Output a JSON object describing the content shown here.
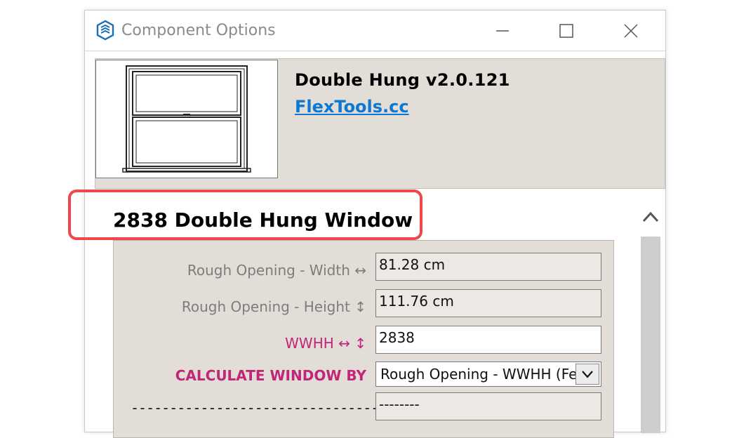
{
  "window": {
    "title": "Component Options",
    "icon": "sketchup-logo-icon",
    "controls": [
      "minimize-icon",
      "maximize-icon",
      "close-icon"
    ]
  },
  "component": {
    "name": "Double Hung v2.0.121",
    "link_text": "FlexTools.cc",
    "thumbnail_icon": "double-hung-window-thumbnail"
  },
  "section": {
    "title": "2838 Double Hung Window"
  },
  "form": {
    "rows": [
      {
        "label": "Rough Opening - Width ↔",
        "value": "81.28 cm"
      },
      {
        "label": "Rough Opening - Height ↕",
        "value": "111.76 cm"
      },
      {
        "label": "WWHH ↔ ↕",
        "value": "2838"
      },
      {
        "label": "CALCULATE WINDOW BY",
        "value": "Rough Opening - WWHH (Fe"
      },
      {
        "label": "------------------------------------",
        "value": "--------"
      }
    ]
  },
  "colors": {
    "accent_magenta": "#c2257a",
    "link_blue": "#0b78d4",
    "highlight_red": "#f0474a",
    "panel_beige": "#e2ddd6"
  }
}
